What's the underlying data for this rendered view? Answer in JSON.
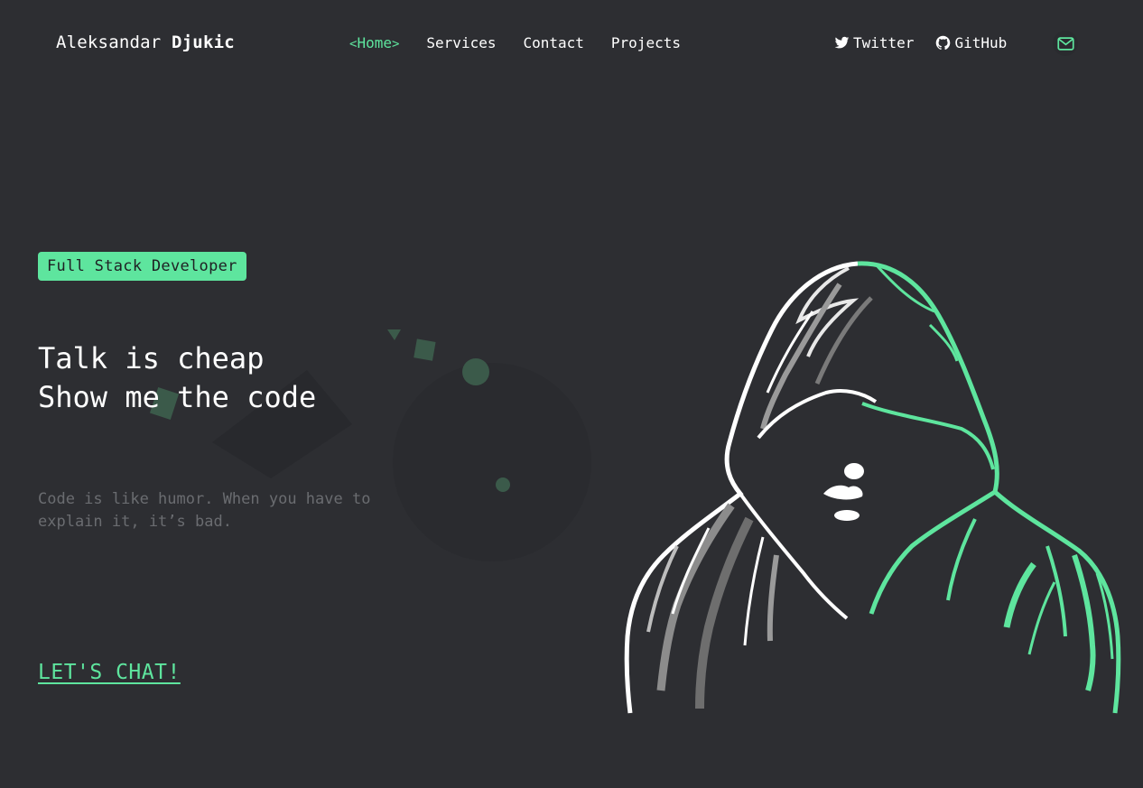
{
  "header": {
    "brand_first": "Aleksandar",
    "brand_last": "Djukic",
    "nav": [
      {
        "label": "Home",
        "active": true
      },
      {
        "label": "Services",
        "active": false
      },
      {
        "label": "Contact",
        "active": false
      },
      {
        "label": "Projects",
        "active": false
      }
    ],
    "social": [
      {
        "label": "Twitter",
        "icon": "twitter-icon"
      },
      {
        "label": "GitHub",
        "icon": "github-icon"
      }
    ],
    "mail_icon": "mail-icon"
  },
  "hero": {
    "tag": "Full Stack Developer",
    "headline_line1": "Talk is cheap",
    "headline_line2": "Show me the code",
    "quote": "Code is like humor. When you have to explain it, it’s bad.",
    "cta": "LET'S CHAT!"
  },
  "colors": {
    "background": "#2d2e32",
    "accent": "#5ee59e",
    "muted_text": "#6a6c70"
  },
  "illustration": "hooded-figure-illustration"
}
